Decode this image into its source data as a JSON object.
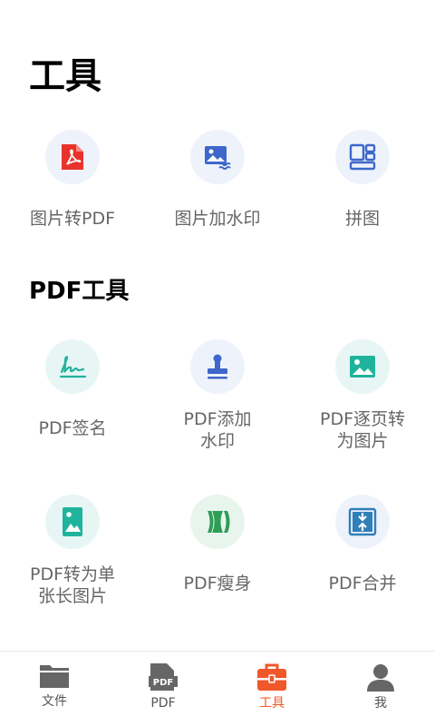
{
  "page": {
    "title": "工具"
  },
  "tools_section": [
    {
      "label": "图片转PDF",
      "icon": "pdf-file-icon"
    },
    {
      "label": "图片加水印",
      "icon": "image-watermark-icon"
    },
    {
      "label": "拼图",
      "icon": "collage-icon"
    }
  ],
  "pdf_section": {
    "title": "PDF工具",
    "items": [
      {
        "label": "PDF签名",
        "icon": "signature-icon"
      },
      {
        "label": "PDF添加水印",
        "icon": "stamp-icon"
      },
      {
        "label": "PDF逐页转为图片",
        "icon": "image-icon"
      },
      {
        "label": "PDF转为单张长图片",
        "icon": "long-image-icon"
      },
      {
        "label": "PDF瘦身",
        "icon": "compress-icon"
      },
      {
        "label": "PDF合并",
        "icon": "merge-icon"
      }
    ]
  },
  "tabbar": {
    "active": "工具",
    "tabs": [
      {
        "label": "文件",
        "icon": "folder-icon"
      },
      {
        "label": "PDF",
        "icon": "pdf-doc-icon"
      },
      {
        "label": "工具",
        "icon": "toolbox-icon"
      },
      {
        "label": "我",
        "icon": "user-icon"
      }
    ]
  },
  "colors": {
    "accent": "#f0582a",
    "pdf_red": "#e8322b",
    "blue_icon": "#3d67c9",
    "teal_icon": "#20b39c",
    "green_icon": "#2e9e57"
  }
}
